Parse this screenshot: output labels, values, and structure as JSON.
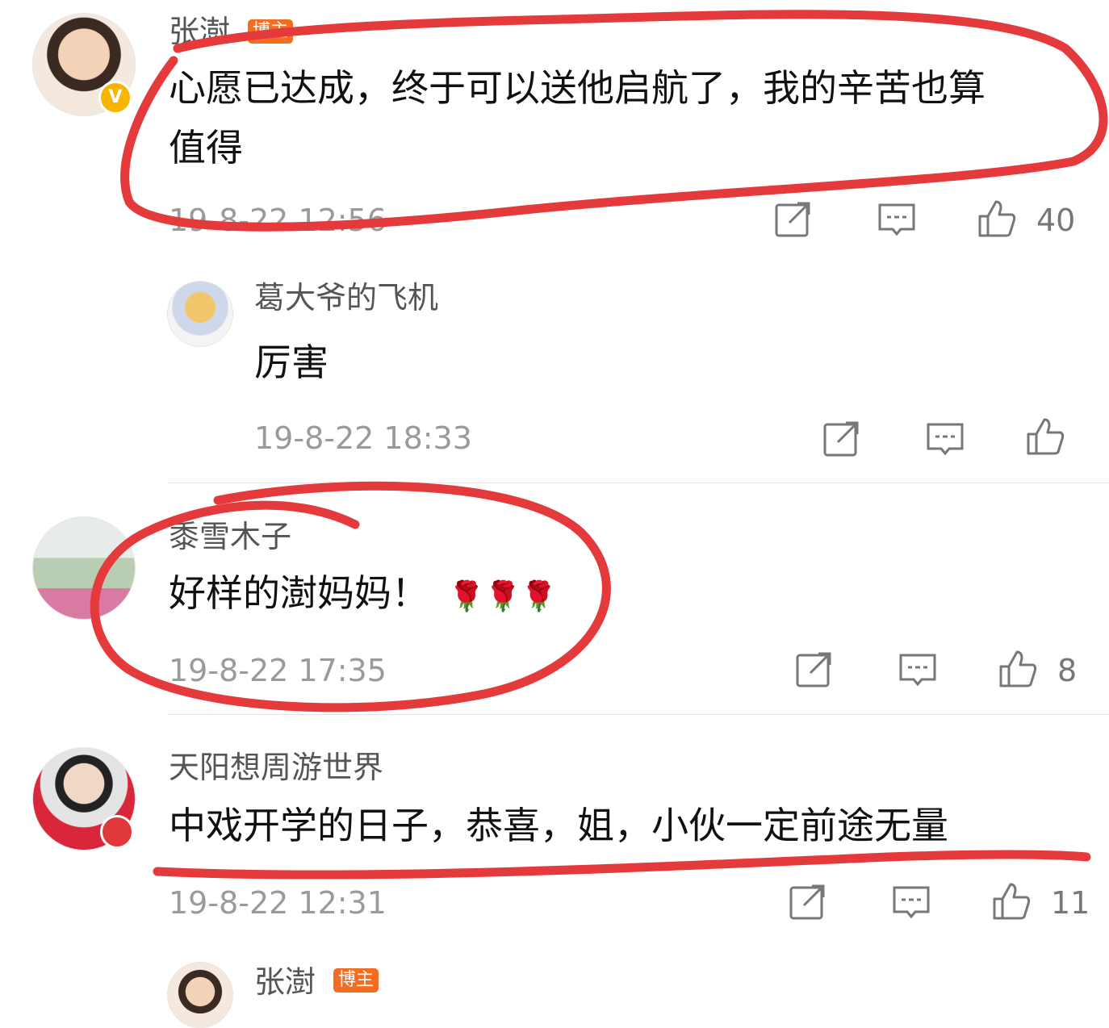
{
  "colors": {
    "accent": "#f26d21",
    "annotation": "#e43a3c",
    "muted": "#9a9a9a"
  },
  "comments": [
    {
      "name": "张澍",
      "badge": "博主",
      "text_line1": "心愿已达成，终于可以送他启航了，我的辛苦也算",
      "text_line2": "值得",
      "time": "19-8-22 12:56",
      "likes": "40",
      "avatar_icon": "verified-v-icon"
    },
    {
      "name": "葛大爷的飞机",
      "text": "厉害",
      "time": "19-8-22 18:33",
      "likes": ""
    },
    {
      "name": "黍雪木子",
      "text": "好样的澍妈妈！",
      "emoji": "🌹🌹🌹",
      "time": "19-8-22 17:35",
      "likes": "8"
    },
    {
      "name": "天阳想周游世界",
      "text": "中戏开学的日子，恭喜，姐，小伙一定前途无量",
      "time": "19-8-22 12:31",
      "likes": "11"
    },
    {
      "name": "张澍",
      "badge": "博主"
    }
  ],
  "icons": {
    "share": "share-icon",
    "reply": "comment-icon",
    "like": "thumbs-up-icon"
  }
}
